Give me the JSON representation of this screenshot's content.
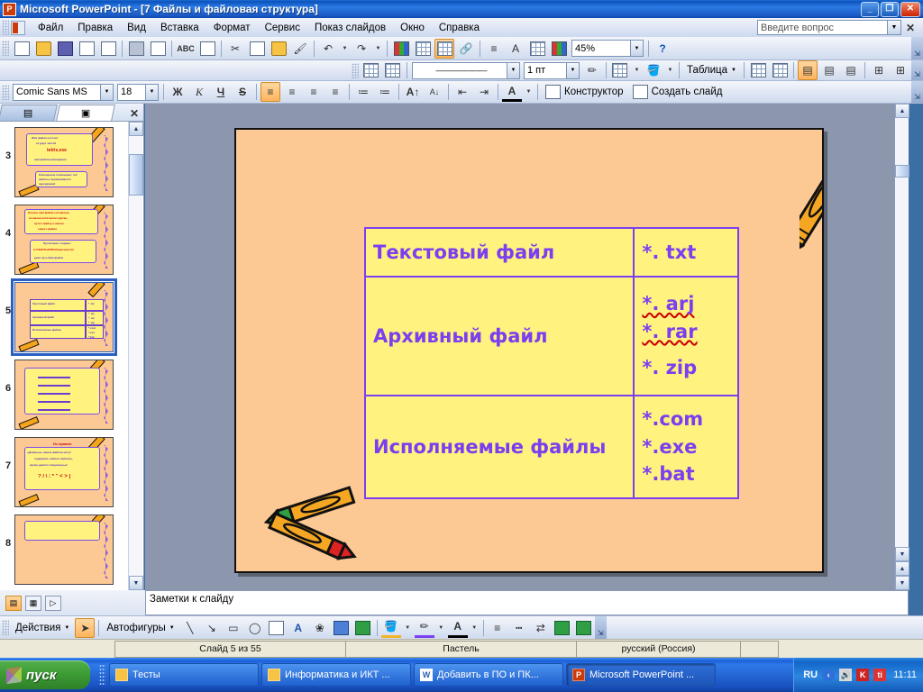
{
  "window": {
    "app_icon": "powerpoint-icon",
    "title": "Microsoft PowerPoint - [7 Файлы и файловая структура]",
    "minimize": "_",
    "maximize": "❐",
    "close": "✕"
  },
  "menu": {
    "items": [
      {
        "label": "Файл",
        "accel": "Ф"
      },
      {
        "label": "Правка",
        "accel": "П"
      },
      {
        "label": "Вид",
        "accel": "В"
      },
      {
        "label": "Вставка",
        "accel": "а"
      },
      {
        "label": "Формат",
        "accel": "м"
      },
      {
        "label": "Сервис",
        "accel": "в"
      },
      {
        "label": "Показ слайдов",
        "accel": "а"
      },
      {
        "label": "Окно",
        "accel": "О"
      },
      {
        "label": "Справка",
        "accel": "С"
      }
    ],
    "ask_question_placeholder": "Введите вопрос",
    "ask_close": "✕"
  },
  "standard_toolbar": {
    "buttons": [
      "new-document-icon",
      "open-folder-icon",
      "save-icon",
      "permission-icon",
      "email-icon",
      "print-icon",
      "print-preview-icon",
      "spelling-icon",
      "research-icon",
      "cut-icon",
      "copy-icon",
      "paste-icon",
      "format-painter-icon",
      "undo-icon",
      "redo-icon",
      "insert-chart-icon",
      "insert-table-icon",
      "tables-borders-icon",
      "insert-hyperlink-icon",
      "expand-all-icon",
      "show-formatting-icon",
      "grid-icon",
      "color-grayscale-icon"
    ],
    "zoom_value": "45%",
    "help_icon": "help-icon",
    "overflow": "toolbar-options"
  },
  "tables_toolbar": {
    "draw_table_icon": "draw-table-icon",
    "eraser_icon": "eraser-icon",
    "line_style_value": "———————",
    "line_weight_value": "1 пт",
    "border_color_icon": "border-color-icon",
    "outside_borders_icon": "outside-borders-icon",
    "fill_color_icon": "fill-color-icon",
    "table_menu_label": "Таблица",
    "merge_cells_icon": "merge-cells-icon",
    "split_cell_icon": "split-cell-icon",
    "align_top_icon": "align-top-icon",
    "align_center_icon": "align-center-icon",
    "align_bottom_icon": "align-bottom-icon",
    "distribute_rows_icon": "distribute-rows-icon",
    "distribute_cols_icon": "distribute-columns-icon",
    "overflow": "toolbar-options"
  },
  "formatting_toolbar": {
    "font_name": "Comic Sans MS",
    "font_size": "18",
    "bold": "Ж",
    "italic": "К",
    "underline": "Ч",
    "shadow": "S",
    "align_left_icon": "align-left-icon",
    "align_center_icon": "align-center-icon",
    "align_right_icon": "align-right-icon",
    "justify_icon": "justify-icon",
    "numbering_icon": "numbered-list-icon",
    "bullets_icon": "bulleted-list-icon",
    "increase_font_icon": "increase-font-size-icon",
    "decrease_font_icon": "decrease-font-size-icon",
    "decrease_indent_icon": "decrease-indent-icon",
    "increase_indent_icon": "increase-indent-icon",
    "font_color_icon": "font-color-icon",
    "design_label": "Конструктор",
    "new_slide_label": "Создать слайд",
    "overflow": "toolbar-options"
  },
  "left_panel": {
    "tab_outline": "outline-tab-icon",
    "tab_slides": "slides-tab-icon",
    "close": "✕",
    "thumbnails": [
      {
        "number": "3",
        "selected": false
      },
      {
        "number": "4",
        "selected": false
      },
      {
        "number": "5",
        "selected": true
      },
      {
        "number": "6",
        "selected": false
      },
      {
        "number": "7",
        "selected": false
      },
      {
        "number": "8",
        "selected": false
      }
    ],
    "thumb3_lines": [
      "Имя файла состоит",
      "из двух частей",
      "tetris.exe",
      "имя файла расширение"
    ],
    "thumb3_box2": [
      "Расширение показывает тип",
      "файла и присваивается",
      "программой"
    ],
    "thumb4_lines": [
      "Полное имя файла составлено",
      "из имени логического диска,",
      "пути к файлу и имени",
      "самого файла"
    ],
    "thumb4_box2": [
      "Прочитаем с экрана:",
      "C:\\ТЕКСТЫ\\ПРОЗА\\рассказ.txt",
      "диск   путь     Имя файла"
    ],
    "thumb7_title": "Из правил",
    "thumb7_lines": [
      "«Длинные» имена файлов могут",
      "содержать любые символы,",
      "кроме девяти специальных:",
      "? / \\ : * \" < > |"
    ]
  },
  "slide": {
    "background_color": "#fcc894",
    "decorations": [
      "crayon-top-right",
      "purple-squiggle",
      "crossed-crayons-bottom-left"
    ],
    "table": {
      "accent_color": "#7b3ff0",
      "cell_fill": "#fff27f",
      "rows": [
        {
          "label": "Текстовый файл",
          "extensions": [
            "*. txt"
          ]
        },
        {
          "label": "Архивный файл",
          "extensions": [
            "*. arj",
            "*. rar",
            "*. zip"
          ]
        },
        {
          "label": "Исполняемые файлы",
          "extensions": [
            "*.com",
            "*.exe",
            "*.bat"
          ]
        }
      ]
    }
  },
  "notes": {
    "placeholder_text": "Заметки к слайду"
  },
  "view_buttons": {
    "normal_icon": "normal-view-icon",
    "sorter_icon": "slide-sorter-icon",
    "show_icon": "slide-show-icon"
  },
  "drawing_toolbar": {
    "actions_label": "Действия",
    "select_icon": "select-arrow-icon",
    "autoshapes_label": "Автофигуры",
    "line_icon": "line-icon",
    "arrow_icon": "arrow-icon",
    "rectangle_icon": "rectangle-icon",
    "oval_icon": "oval-icon",
    "textbox_icon": "text-box-icon",
    "wordart_icon": "wordart-icon",
    "diagram_icon": "diagram-icon",
    "clipart_icon": "clip-art-icon",
    "picture_icon": "insert-picture-icon",
    "fill_color_icon": "fill-color-icon",
    "line_color_icon": "line-color-icon",
    "font_color_icon": "font-color-icon",
    "line_style_icon": "line-style-icon",
    "dash_style_icon": "dash-style-icon",
    "arrow_style_icon": "arrow-style-icon",
    "shadow_icon": "shadow-style-icon",
    "3d_icon": "3d-style-icon",
    "overflow": "toolbar-options"
  },
  "status_bar": {
    "slide_counter": "Слайд 5 из 55",
    "design_template": "Пастель",
    "language": "русский (Россия)"
  },
  "taskbar": {
    "start_label": "пуск",
    "tasks": [
      {
        "label": "Тесты",
        "icon": "folder-icon",
        "active": false
      },
      {
        "label": "Информатика и ИКТ ...",
        "icon": "folder-icon",
        "active": false
      },
      {
        "label": "Добавить в ПО и ПК...",
        "icon": "word-icon",
        "active": false
      },
      {
        "label": "Microsoft PowerPoint ...",
        "icon": "powerpoint-icon",
        "active": true
      }
    ],
    "language_indicator": "RU",
    "tray_icons": [
      "chevron-left-icon",
      "volume-icon",
      "antivirus-icon",
      "keyboard-icon"
    ],
    "clock": "11:11"
  }
}
